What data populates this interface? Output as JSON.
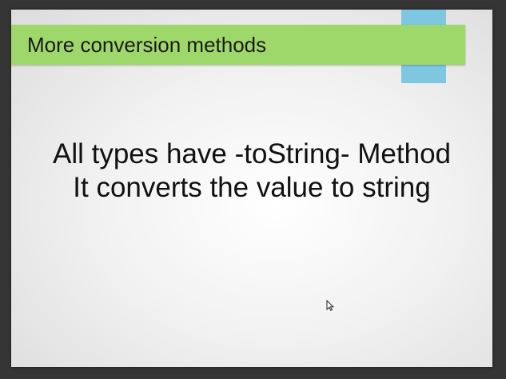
{
  "slide": {
    "title": "More conversion methods",
    "body_lines": [
      "All types have -toString- Method",
      "It converts the value to string"
    ]
  },
  "colors": {
    "title_bar": "#9fd86a",
    "accent_tab": "#7ec7e0",
    "frame": "#353535"
  },
  "icons": {
    "cursor": "mouse-pointer-icon"
  }
}
